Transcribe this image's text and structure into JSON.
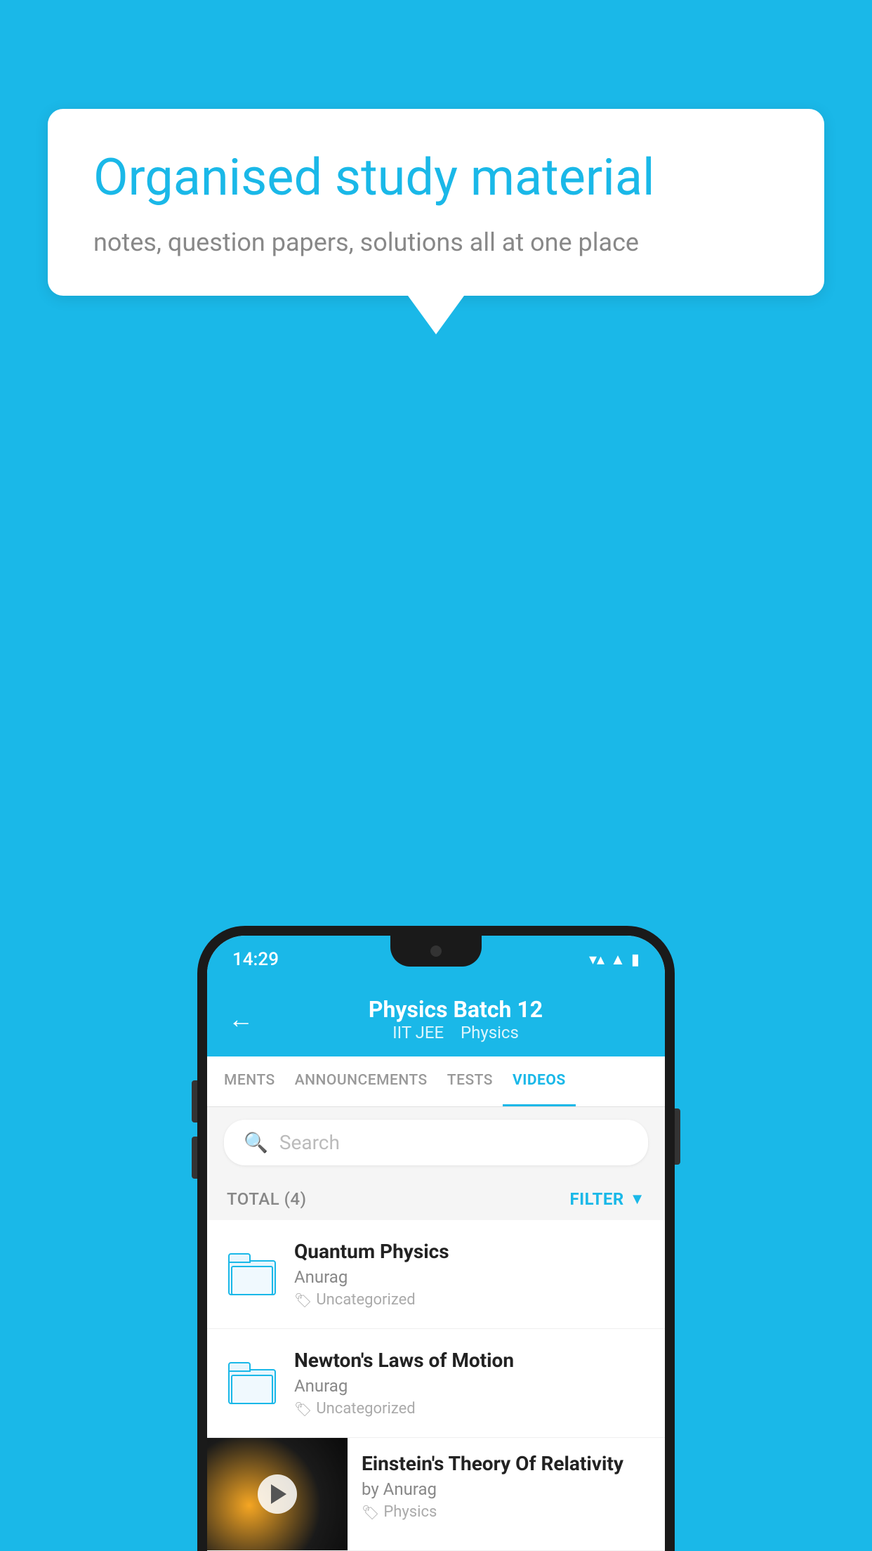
{
  "background_color": "#1ab8e8",
  "bubble": {
    "heading": "Organised study material",
    "subtext": "notes, question papers, solutions all at one place"
  },
  "phone": {
    "status_bar": {
      "time": "14:29",
      "wifi": "▼",
      "signal": "▲",
      "battery": "▮"
    },
    "header": {
      "back_label": "←",
      "title": "Physics Batch 12",
      "subtitle_part1": "IIT JEE",
      "subtitle_part2": "Physics"
    },
    "tabs": [
      {
        "label": "MENTS",
        "active": false
      },
      {
        "label": "ANNOUNCEMENTS",
        "active": false
      },
      {
        "label": "TESTS",
        "active": false
      },
      {
        "label": "VIDEOS",
        "active": true
      }
    ],
    "search": {
      "placeholder": "Search"
    },
    "filter": {
      "total_label": "TOTAL (4)",
      "filter_label": "FILTER"
    },
    "video_list": [
      {
        "title": "Quantum Physics",
        "author": "Anurag",
        "tag": "Uncategorized",
        "has_thumb": false
      },
      {
        "title": "Newton's Laws of Motion",
        "author": "Anurag",
        "tag": "Uncategorized",
        "has_thumb": false
      },
      {
        "title": "Einstein's Theory Of Relativity",
        "author": "by Anurag",
        "tag": "Physics",
        "has_thumb": true
      }
    ]
  }
}
